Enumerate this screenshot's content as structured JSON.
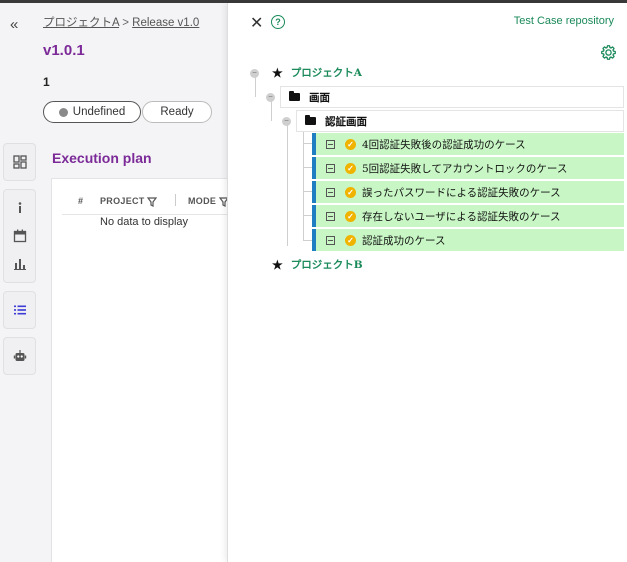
{
  "breadcrumb": {
    "project": "プロジェクトA",
    "separator": ">",
    "release": "Release v1.0"
  },
  "version": "v1.0.1",
  "count": "1",
  "status": {
    "undefined_label": "Undefined",
    "ready_label": "Ready"
  },
  "execution_plan": {
    "title": "Execution plan",
    "columns": [
      "#",
      "PROJECT",
      "MODE"
    ],
    "empty_text": "No data to display"
  },
  "drawer": {
    "title": "Test Case repository",
    "help_label": "?",
    "tree": {
      "project_a": "プロジェクトA",
      "folder_1": "画面",
      "folder_2": "認証画面",
      "cases": [
        "4回認証失敗後の認証成功のケース",
        "5回認証失敗してアカウントロックのケース",
        "誤ったパスワードによる認証失敗のケース",
        "存在しないユーザによる認証失敗のケース",
        "認証成功のケース"
      ],
      "project_b": "プロジェクトB"
    }
  },
  "colors": {
    "accent_purple": "#7b2a98",
    "accent_green": "#1b8a5a",
    "case_bg": "#c8f7c5",
    "case_bar": "#1f7ec1"
  },
  "icons": {
    "collapse": "double-chevron-left-icon",
    "close": "close-icon",
    "help": "help-circle-icon",
    "gear": "gear-icon",
    "sidebar": [
      "dashboard-icon",
      "info-icon",
      "calendar-icon",
      "bar-chart-icon",
      "list-icon",
      "robot-icon"
    ]
  }
}
